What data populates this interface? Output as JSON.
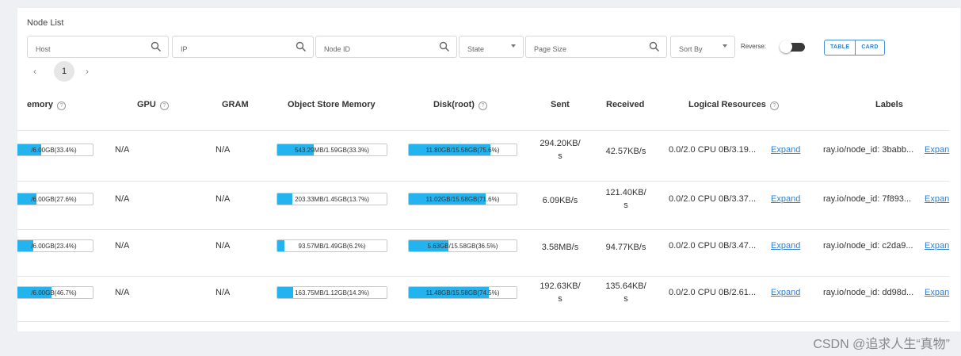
{
  "panel": {
    "title": "Node List"
  },
  "filters": {
    "host_placeholder": "Host",
    "ip_placeholder": "IP",
    "node_id_placeholder": "Node ID",
    "state_label": "State",
    "page_size_placeholder": "Page Size",
    "sort_by_label": "Sort By",
    "reverse_label": "Reverse:",
    "reverse_on": false,
    "view_table": "TABLE",
    "view_card": "CARD",
    "accent": "#2f7fd1"
  },
  "pagination": {
    "prev": "‹",
    "current": "1",
    "next": "›"
  },
  "columns": {
    "memory": "emory",
    "gpu": "GPU",
    "gram": "GRAM",
    "object_store": "Object Store Memory",
    "disk": "Disk(root)",
    "sent": "Sent",
    "received": "Received",
    "logical": "Logical Resources",
    "labels": "Labels",
    "help_glyph": "?"
  },
  "bar_color": "#23b3ee",
  "rows": [
    {
      "memory": {
        "text": "/6.00GB(33.4%)",
        "frac": 0.334
      },
      "gpu": "N/A",
      "gram": "N/A",
      "object_store": {
        "text": "543.29MB/1.59GB(33.3%)",
        "frac": 0.333
      },
      "disk": {
        "text": "11.80GB/15.58GB(75.6%)",
        "frac": 0.756
      },
      "sent": "294.20KB/\ns",
      "received": "42.57KB/s",
      "logical": "0.0/2.0 CPU 0B/3.19...",
      "expand": "Expand",
      "label": "ray.io/node_id: 3babb...",
      "label_expand": "Expan"
    },
    {
      "memory": {
        "text": "/6.00GB(27.6%)",
        "frac": 0.276
      },
      "gpu": "N/A",
      "gram": "N/A",
      "object_store": {
        "text": "203.33MB/1.45GB(13.7%)",
        "frac": 0.137
      },
      "disk": {
        "text": "11.02GB/15.58GB(71.6%)",
        "frac": 0.716
      },
      "sent": "6.09KB/s",
      "received": "121.40KB/\ns",
      "logical": "0.0/2.0 CPU 0B/3.37...",
      "expand": "Expand",
      "label": "ray.io/node_id: 7f893...",
      "label_expand": "Expan"
    },
    {
      "memory": {
        "text": "/6.00GB(23.4%)",
        "frac": 0.234
      },
      "gpu": "N/A",
      "gram": "N/A",
      "object_store": {
        "text": "93.57MB/1.49GB(6.2%)",
        "frac": 0.062
      },
      "disk": {
        "text": "5.63GB/15.58GB(36.5%)",
        "frac": 0.365
      },
      "sent": "3.58MB/s",
      "received": "94.77KB/s",
      "logical": "0.0/2.0 CPU 0B/3.47...",
      "expand": "Expand",
      "label": "ray.io/node_id: c2da9...",
      "label_expand": "Expan"
    },
    {
      "memory": {
        "text": "/6.00GB(46.7%)",
        "frac": 0.467
      },
      "gpu": "N/A",
      "gram": "N/A",
      "object_store": {
        "text": "163.75MB/1.12GB(14.3%)",
        "frac": 0.143
      },
      "disk": {
        "text": "11.48GB/15.58GB(74.5%)",
        "frac": 0.745
      },
      "sent": "192.63KB/\ns",
      "received": "135.64KB/\ns",
      "logical": "0.0/2.0 CPU 0B/2.61...",
      "expand": "Expand",
      "label": "ray.io/node_id: dd98d...",
      "label_expand": "Expan"
    }
  ],
  "watermark": "CSDN @追求人生“真物”"
}
